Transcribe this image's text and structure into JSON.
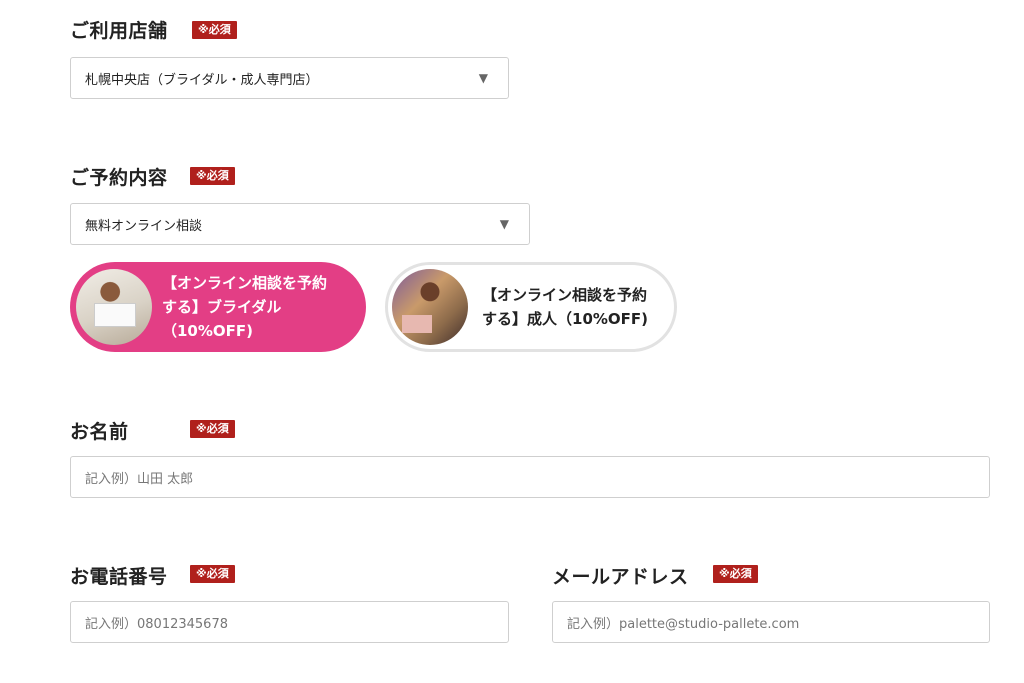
{
  "required_badge": "※必須",
  "store": {
    "label": "ご利用店舗",
    "selected": "札幌中央店（ブライダル・成人専門店）"
  },
  "reservation": {
    "label": "ご予約内容",
    "selected": "無料オンライン相談",
    "plans": [
      {
        "line1": "【オンライン相談を予約",
        "line2": "する】ブライダル",
        "line3": "（10%OFF)"
      },
      {
        "line1": "【オンライン相談を予約",
        "line2": "する】成人（10%OFF)"
      }
    ]
  },
  "name": {
    "label": "お名前",
    "placeholder": "記入例）山田 太郎"
  },
  "phone": {
    "label": "お電話番号",
    "placeholder": "記入例）08012345678"
  },
  "email": {
    "label": "メールアドレス",
    "placeholder": "記入例）palette@studio-pallete.com"
  },
  "icons": {
    "dropdown": "triangle-down-icon"
  },
  "colors": {
    "accent_pink": "#e33e85",
    "required_red": "#b0201c"
  }
}
